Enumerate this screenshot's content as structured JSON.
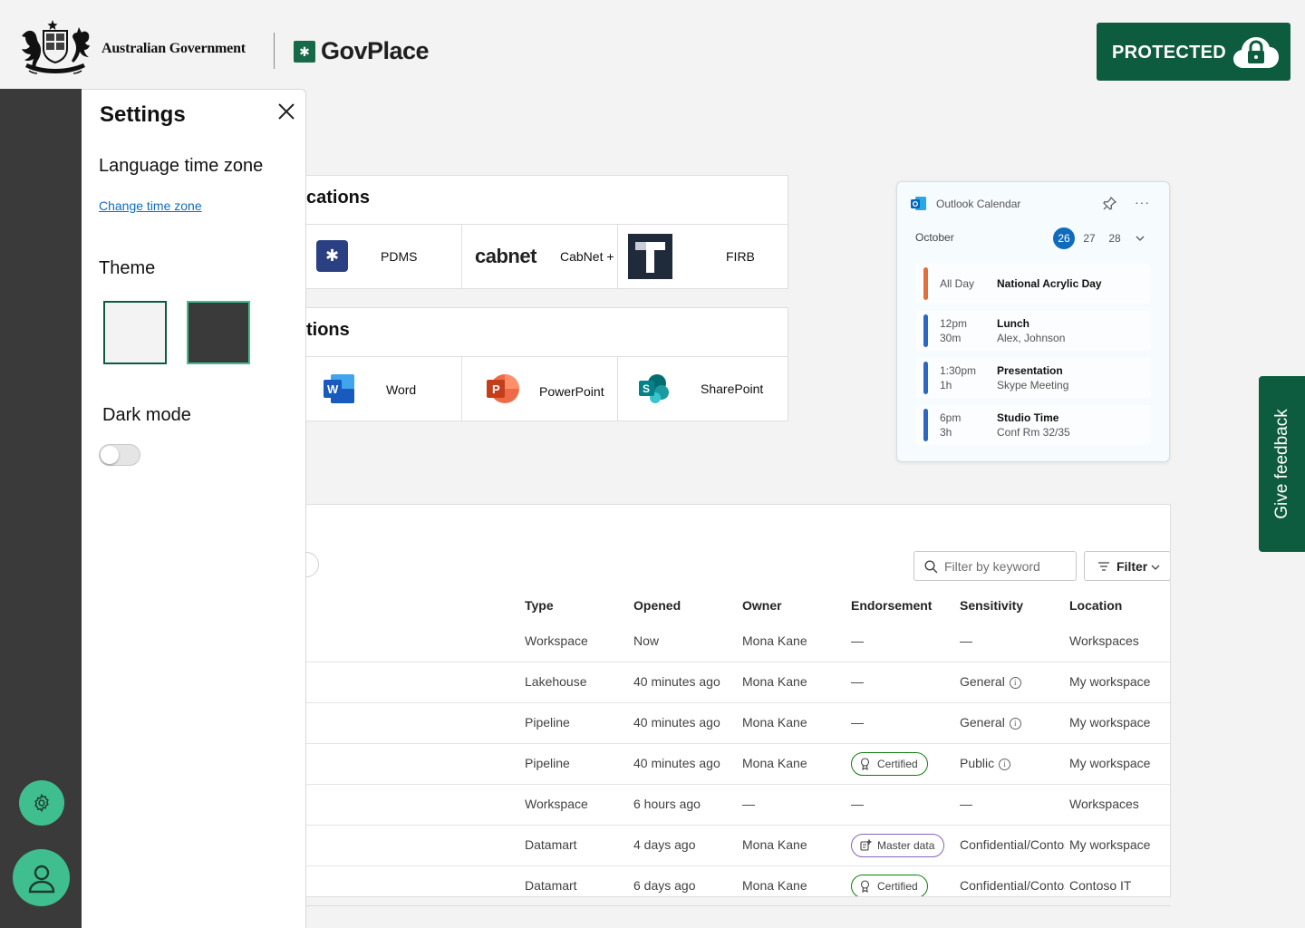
{
  "header": {
    "gov_name": "Australian Government",
    "brand_name": "GovPlace",
    "classification": "PROTECTED",
    "brand_color": "#0e5c3f",
    "icons": [
      "coat-of-arms-icon",
      "govplace-logo-icon",
      "cloud-lock-icon"
    ]
  },
  "rail": {
    "accent_color": "#3fbf8f",
    "icons": [
      "gear-icon",
      "person-icon"
    ]
  },
  "settings": {
    "title": "Settings",
    "language_label": "Language time zone",
    "change_time_zone": "Change time zone",
    "theme_label": "Theme",
    "themes": [
      {
        "name": "light",
        "color": "#f3f3f3"
      },
      {
        "name": "dark",
        "color": "#3a3a3a"
      }
    ],
    "dark_mode_label": "Dark mode",
    "dark_mode_on": false
  },
  "apps": {
    "section1_title": "cations",
    "section1_tiles": [
      {
        "label": "PDMS",
        "icon": "pdms-icon"
      },
      {
        "label": "CabNet +",
        "logo_text": "cabnet",
        "icon": "cabnet-logo"
      },
      {
        "label": "FIRB",
        "icon": "firb-t-icon"
      }
    ],
    "section2_title": "tions",
    "section2_tiles": [
      {
        "label": "Word",
        "icon": "word-icon"
      },
      {
        "label": "PowerPoint",
        "icon": "powerpoint-icon"
      },
      {
        "label": "SharePoint",
        "icon": "sharepoint-icon"
      }
    ]
  },
  "outlook": {
    "title": "Outlook Calendar",
    "month": "October",
    "days": [
      "26",
      "27",
      "28"
    ],
    "selected_day": "26",
    "events": [
      {
        "time": "All Day",
        "duration": "",
        "title": "National Acrylic Day",
        "subtitle": "",
        "color": "#e2703a"
      },
      {
        "time": "12pm",
        "duration": "30m",
        "title": "Lunch",
        "subtitle": "Alex, Johnson",
        "color": "#2a68c2"
      },
      {
        "time": "1:30pm",
        "duration": "1h",
        "title": "Presentation",
        "subtitle": "Skype Meeting",
        "color": "#2a68c2"
      },
      {
        "time": "6pm",
        "duration": "3h",
        "title": "Studio Time",
        "subtitle": "Conf Rm 32/35",
        "color": "#2a68c2"
      }
    ]
  },
  "feedback": {
    "label": "Give feedback"
  },
  "table": {
    "search_placeholder": "Filter by keyword",
    "filter_label": "Filter",
    "columns": [
      "Type",
      "Opened",
      "Owner",
      "Endorsement",
      "Sensitivity",
      "Location"
    ],
    "rows": [
      {
        "type": "Workspace",
        "opened": "Now",
        "owner": "Mona Kane",
        "endorsement": "—",
        "endorsement_kind": "none",
        "sensitivity": "—",
        "sens_info": false,
        "location": "Workspaces"
      },
      {
        "type": "Lakehouse",
        "opened": "40 minutes ago",
        "owner": "Mona Kane",
        "endorsement": "—",
        "endorsement_kind": "none",
        "sensitivity": "General",
        "sens_info": true,
        "location": "My workspace"
      },
      {
        "type": "Pipeline",
        "opened": "40 minutes ago",
        "owner": "Mona Kane",
        "endorsement": "—",
        "endorsement_kind": "none",
        "sensitivity": "General",
        "sens_info": true,
        "location": "My workspace"
      },
      {
        "type": "Pipeline",
        "opened": "40 minutes ago",
        "owner": "Mona Kane",
        "endorsement": "Certified",
        "endorsement_kind": "certified",
        "sensitivity": "Public",
        "sens_info": true,
        "location": "My workspace"
      },
      {
        "type": "Workspace",
        "opened": "6 hours ago",
        "owner": "—",
        "endorsement": "—",
        "endorsement_kind": "none",
        "sensitivity": "—",
        "sens_info": false,
        "location": "Workspaces"
      },
      {
        "type": "Datamart",
        "opened": "4 days ago",
        "owner": "Mona Kane",
        "endorsement": "Master data",
        "endorsement_kind": "master",
        "sensitivity": "Confidential/Contoso",
        "sens_info": false,
        "location": "My workspace"
      },
      {
        "type": "Datamart",
        "opened": "6 days ago",
        "owner": "Mona Kane",
        "endorsement": "Certified",
        "endorsement_kind": "certified",
        "sensitivity": "Confidential/Contoso",
        "sens_info": false,
        "location": "Contoso IT"
      }
    ]
  }
}
